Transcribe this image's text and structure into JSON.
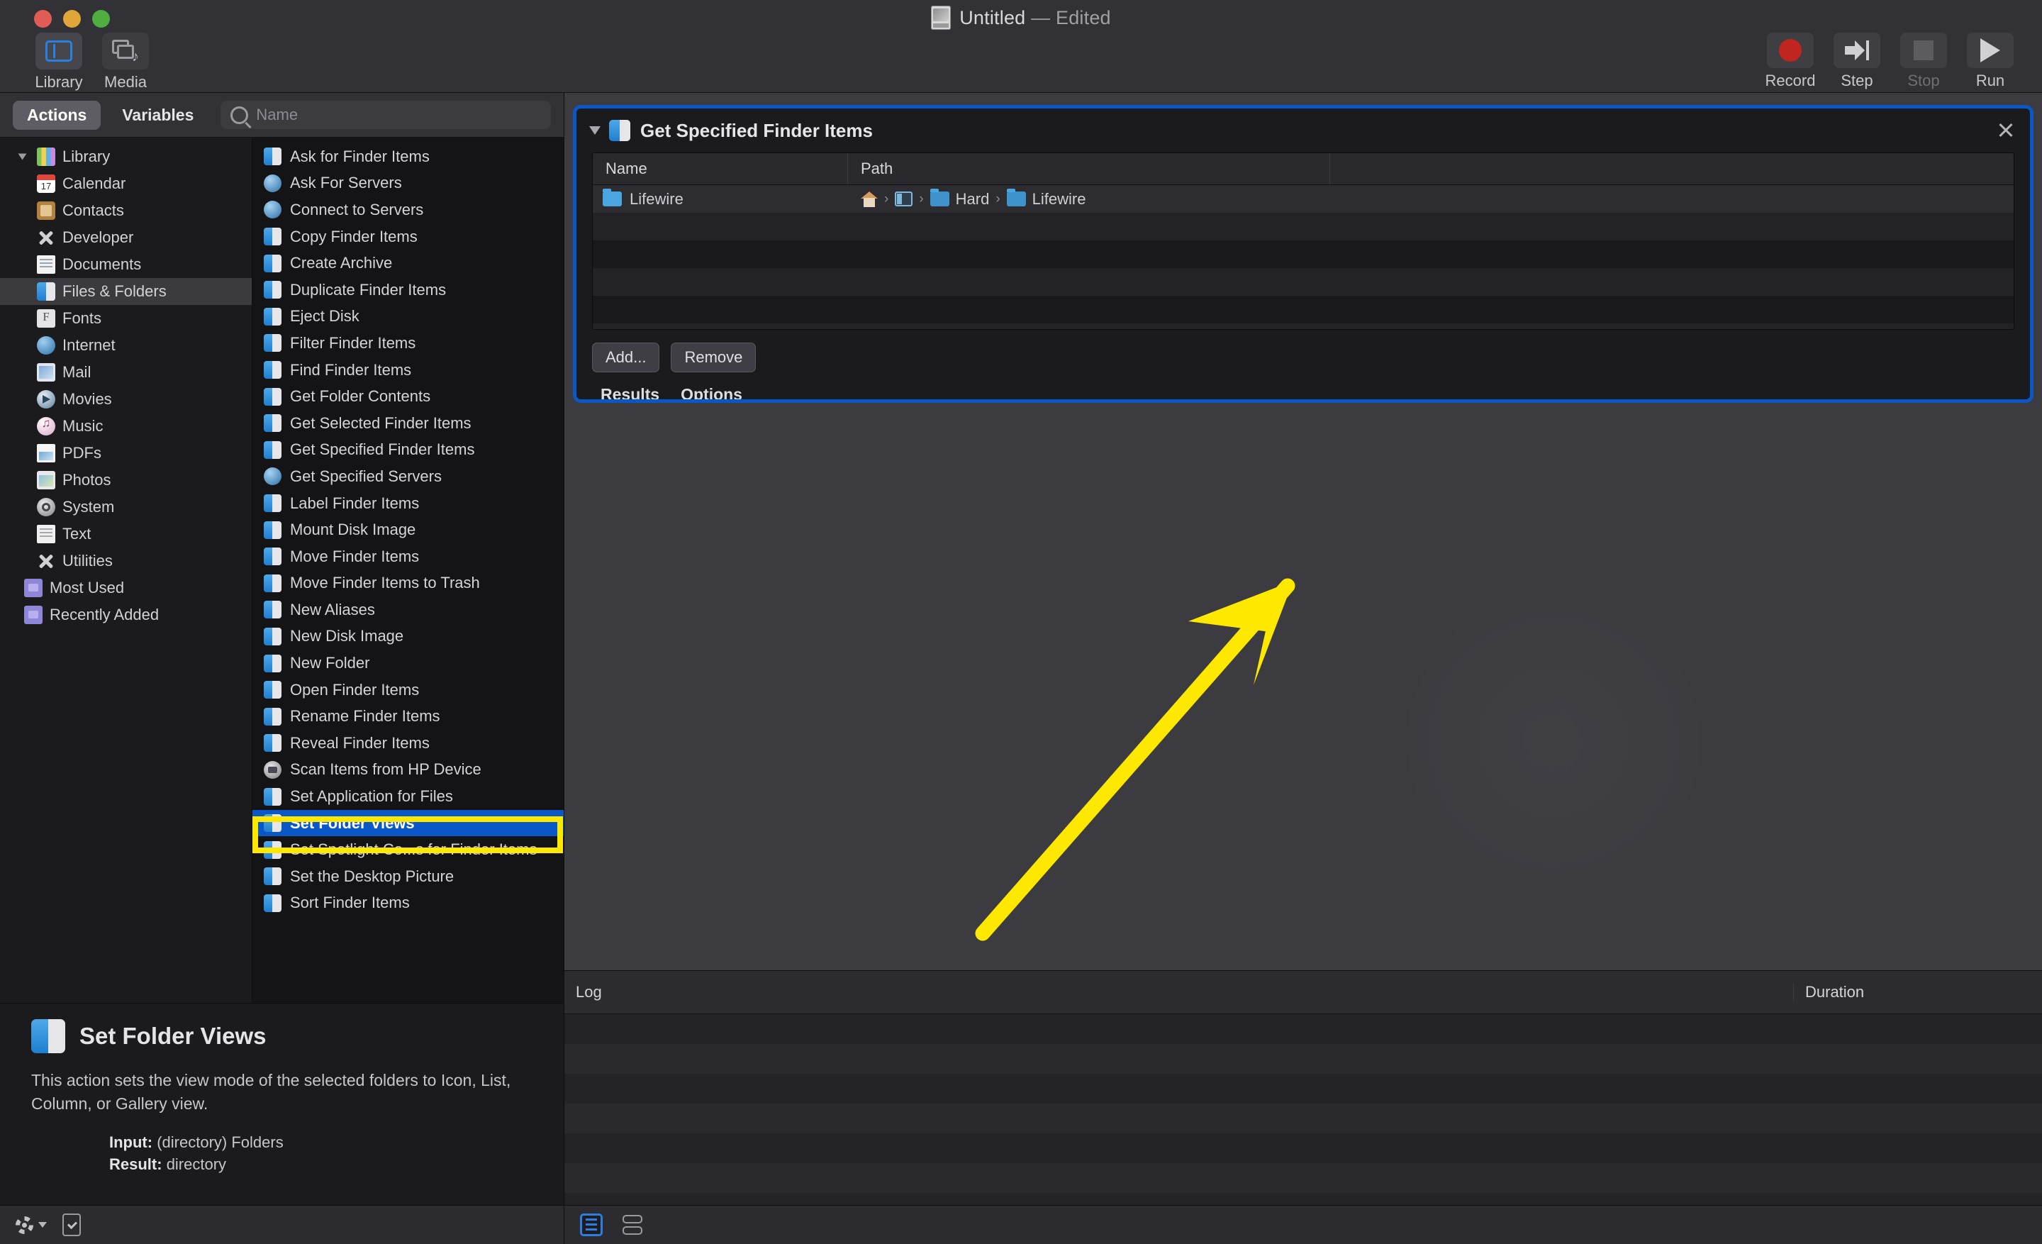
{
  "window": {
    "title": "Untitled",
    "title_suffix": "— Edited",
    "doc_icon": "automator-document-icon"
  },
  "toolbar": {
    "left": [
      {
        "label": "Library",
        "icon": "sidebar-icon",
        "selected": true
      },
      {
        "label": "Media",
        "icon": "media-icon",
        "selected": false
      }
    ],
    "right": [
      {
        "label": "Record",
        "icon": "record-circle-icon",
        "enabled": true
      },
      {
        "label": "Step",
        "icon": "step-arrow-icon",
        "enabled": true
      },
      {
        "label": "Stop",
        "icon": "stop-square-icon",
        "enabled": false
      },
      {
        "label": "Run",
        "icon": "play-triangle-icon",
        "enabled": true
      }
    ]
  },
  "library_panel": {
    "tabs": [
      {
        "label": "Actions",
        "selected": true
      },
      {
        "label": "Variables",
        "selected": false
      }
    ],
    "search": {
      "placeholder": "Name",
      "value": "",
      "icon": "search-icon"
    },
    "tree": [
      {
        "label": "Library",
        "icon": "library-icon",
        "level": 0,
        "expanded": true,
        "selected": false
      },
      {
        "label": "Calendar",
        "icon": "calendar-icon",
        "level": 1,
        "selected": false
      },
      {
        "label": "Contacts",
        "icon": "contacts-icon",
        "level": 1,
        "selected": false
      },
      {
        "label": "Developer",
        "icon": "developer-icon",
        "level": 1,
        "selected": false
      },
      {
        "label": "Documents",
        "icon": "documents-icon",
        "level": 1,
        "selected": false
      },
      {
        "label": "Files & Folders",
        "icon": "files-folders-icon",
        "level": 1,
        "selected": true
      },
      {
        "label": "Fonts",
        "icon": "fonts-icon",
        "level": 1,
        "selected": false
      },
      {
        "label": "Internet",
        "icon": "internet-icon",
        "level": 1,
        "selected": false
      },
      {
        "label": "Mail",
        "icon": "mail-icon",
        "level": 1,
        "selected": false
      },
      {
        "label": "Movies",
        "icon": "movies-icon",
        "level": 1,
        "selected": false
      },
      {
        "label": "Music",
        "icon": "music-icon",
        "level": 1,
        "selected": false
      },
      {
        "label": "PDFs",
        "icon": "pdfs-icon",
        "level": 1,
        "selected": false
      },
      {
        "label": "Photos",
        "icon": "photos-icon",
        "level": 1,
        "selected": false
      },
      {
        "label": "System",
        "icon": "system-icon",
        "level": 1,
        "selected": false
      },
      {
        "label": "Text",
        "icon": "text-icon",
        "level": 1,
        "selected": false
      },
      {
        "label": "Utilities",
        "icon": "utilities-icon",
        "level": 1,
        "selected": false
      },
      {
        "label": "Most Used",
        "icon": "smart-folder-icon",
        "level": 0.5,
        "selected": false
      },
      {
        "label": "Recently Added",
        "icon": "smart-folder-icon",
        "level": 0.5,
        "selected": false
      }
    ],
    "actions": [
      {
        "label": "Ask for Finder Items",
        "icon": "finder-icon",
        "selected": false
      },
      {
        "label": "Ask For Servers",
        "icon": "network-icon",
        "selected": false
      },
      {
        "label": "Connect to Servers",
        "icon": "network-icon",
        "selected": false
      },
      {
        "label": "Copy Finder Items",
        "icon": "finder-icon",
        "selected": false
      },
      {
        "label": "Create Archive",
        "icon": "finder-icon",
        "selected": false
      },
      {
        "label": "Duplicate Finder Items",
        "icon": "finder-icon",
        "selected": false
      },
      {
        "label": "Eject Disk",
        "icon": "finder-icon",
        "selected": false
      },
      {
        "label": "Filter Finder Items",
        "icon": "finder-icon",
        "selected": false
      },
      {
        "label": "Find Finder Items",
        "icon": "finder-icon",
        "selected": false
      },
      {
        "label": "Get Folder Contents",
        "icon": "finder-icon",
        "selected": false
      },
      {
        "label": "Get Selected Finder Items",
        "icon": "finder-icon",
        "selected": false
      },
      {
        "label": "Get Specified Finder Items",
        "icon": "finder-icon",
        "selected": false
      },
      {
        "label": "Get Specified Servers",
        "icon": "network-icon",
        "selected": false
      },
      {
        "label": "Label Finder Items",
        "icon": "finder-icon",
        "selected": false
      },
      {
        "label": "Mount Disk Image",
        "icon": "finder-icon",
        "selected": false
      },
      {
        "label": "Move Finder Items",
        "icon": "finder-icon",
        "selected": false
      },
      {
        "label": "Move Finder Items to Trash",
        "icon": "finder-icon",
        "selected": false
      },
      {
        "label": "New Aliases",
        "icon": "finder-icon",
        "selected": false
      },
      {
        "label": "New Disk Image",
        "icon": "finder-icon",
        "selected": false
      },
      {
        "label": "New Folder",
        "icon": "finder-icon",
        "selected": false
      },
      {
        "label": "Open Finder Items",
        "icon": "finder-icon",
        "selected": false
      },
      {
        "label": "Rename Finder Items",
        "icon": "finder-icon",
        "selected": false
      },
      {
        "label": "Reveal Finder Items",
        "icon": "finder-icon",
        "selected": false
      },
      {
        "label": "Scan Items from HP Device",
        "icon": "scanner-icon",
        "selected": false
      },
      {
        "label": "Set Application for Files",
        "icon": "finder-icon",
        "selected": false
      },
      {
        "label": "Set Folder Views",
        "icon": "finder-icon",
        "selected": true
      },
      {
        "label": "Set Spotlight Co...s for Finder Items",
        "icon": "finder-icon",
        "selected": false
      },
      {
        "label": "Set the Desktop Picture",
        "icon": "finder-icon",
        "selected": false
      },
      {
        "label": "Sort Finder Items",
        "icon": "finder-icon",
        "selected": false
      }
    ]
  },
  "description": {
    "title": "Set Folder Views",
    "icon": "finder-icon",
    "body": "This action sets the view mode of the selected folders to Icon, List, Column, or Gallery view.",
    "input_label": "Input:",
    "input_value": "(directory) Folders",
    "result_label": "Result:",
    "result_value": "directory"
  },
  "left_status": {
    "gear_icon": "gear-dropdown-icon",
    "check_icon": "enable-action-icon"
  },
  "workflow": {
    "action_card": {
      "title": "Get Specified Finder Items",
      "icon": "finder-icon",
      "disclosure_icon": "disclosure-triangle-icon",
      "close_icon": "close-icon",
      "columns": [
        "Name",
        "Path"
      ],
      "rows": [
        {
          "name": "Lifewire",
          "name_icon": "folder-icon",
          "path": [
            {
              "label": "",
              "icon": "home-icon"
            },
            {
              "label": "",
              "icon": "window-icon"
            },
            {
              "label": "Hard",
              "icon": "folder-icon"
            },
            {
              "label": "Lifewire",
              "icon": "folder-icon"
            }
          ]
        }
      ],
      "buttons": [
        {
          "label": "Add..."
        },
        {
          "label": "Remove"
        }
      ],
      "tabs": [
        {
          "label": "Results"
        },
        {
          "label": "Options"
        }
      ]
    },
    "annotation": {
      "arrow_color": "#FFE800",
      "highlight_box_color": "#FFE800",
      "points_to": "Set Folder Views"
    }
  },
  "log": {
    "columns": [
      "Log",
      "Duration"
    ]
  },
  "right_status": {
    "view_list_icon": "log-list-view-icon",
    "view_stack_icon": "log-stack-view-icon"
  }
}
